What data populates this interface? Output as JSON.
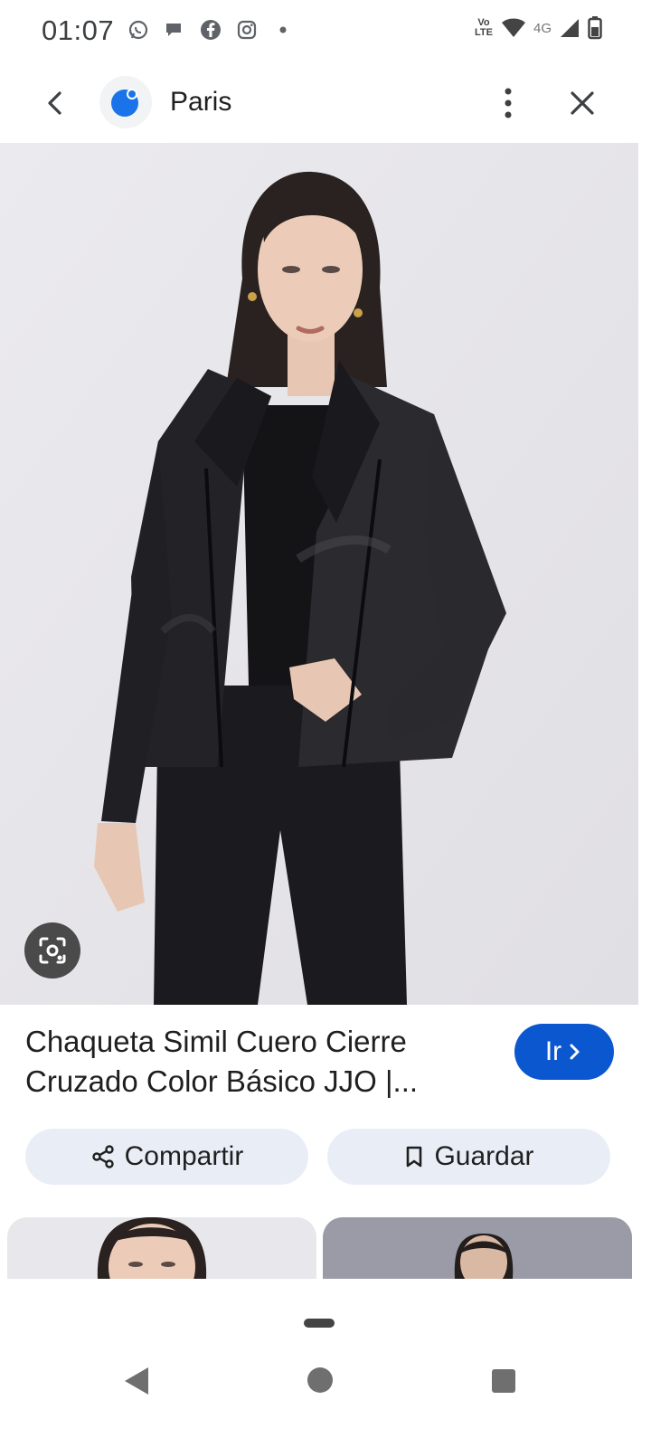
{
  "status_bar": {
    "time": "01:07",
    "left_icons": [
      "whatsapp-icon",
      "chat-icon",
      "facebook-icon",
      "instagram-icon",
      "dot-icon"
    ],
    "volte": "Vo LTE",
    "network": "4G"
  },
  "top_bar": {
    "site_name": "Paris"
  },
  "product": {
    "title": "Chaqueta Simil Cuero Cierre Cruzado Color Básico JJO |...",
    "go_label": "Ir",
    "share_label": "Compartir",
    "save_label": "Guardar"
  },
  "colors": {
    "accent": "#0b57d0",
    "pill_bg": "#e9eef6",
    "image_bg": "#e6e5ea"
  }
}
